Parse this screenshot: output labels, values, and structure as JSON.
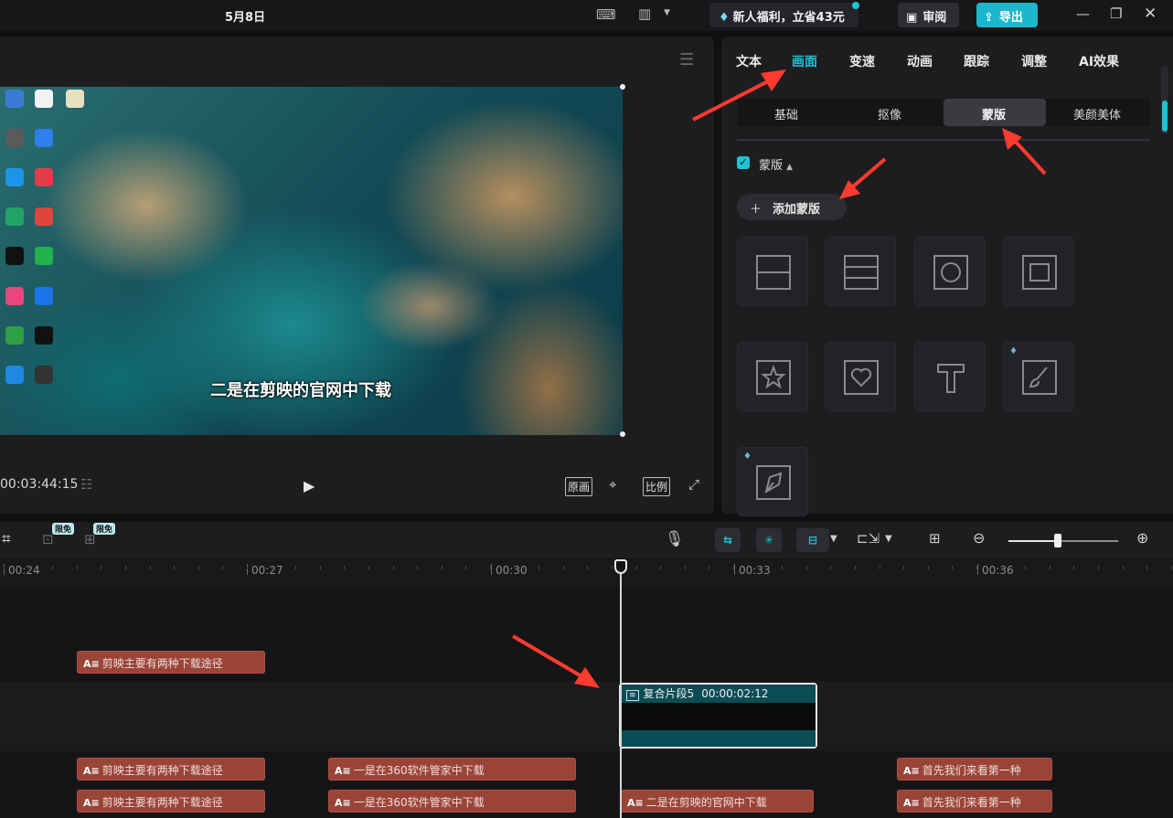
{
  "titlebar": {
    "date": "5月8日",
    "promo": "新人福利，立省43元",
    "review": "审阅",
    "export": "导出"
  },
  "player": {
    "subtitle": "二是在剪映的官网中下载",
    "timecode": "00:03:44:15",
    "original_btn": "原画",
    "ratio_btn": "比例",
    "desktop_icons": [
      {
        "color": "#3b7bd8"
      },
      {
        "color": "#f2f2f2"
      },
      {
        "color": "#e8e1c0"
      },
      {
        "color": "#5a5a5a"
      },
      {
        "color": "#2f80ed"
      },
      {
        "color": "#1d94e8"
      },
      {
        "color": "#e23b4a"
      },
      {
        "color": "#21a366"
      },
      {
        "color": "#e0453a"
      },
      {
        "color": "#111111"
      },
      {
        "color": "#22b14c"
      },
      {
        "color": "#e8467c"
      },
      {
        "color": "#1a73e8"
      },
      {
        "color": "#2ea043"
      },
      {
        "color": "#111111"
      },
      {
        "color": "#1e88e5"
      },
      {
        "color": "#333333"
      }
    ]
  },
  "panel": {
    "tabs": [
      "文本",
      "画面",
      "变速",
      "动画",
      "跟踪",
      "调整",
      "AI效果"
    ],
    "active_tab": "画面",
    "subtabs": [
      "基础",
      "抠像",
      "蒙版",
      "美颜美体"
    ],
    "active_subtab": "蒙版",
    "section_label": "蒙版",
    "add_mask": "添加蒙版",
    "mask_shapes": [
      "line-split",
      "mirror",
      "circle",
      "rectangle",
      "star",
      "heart",
      "text",
      "brush",
      "pen"
    ]
  },
  "toolbar": {
    "badge1": "限免",
    "badge2": "限免"
  },
  "timeline": {
    "ruler_labels": [
      "00:24",
      "00:27",
      "00:30",
      "00:33",
      "00:36"
    ],
    "compound": {
      "name": "复合片段5",
      "duration": "00:00:02:12"
    },
    "text_track_a": [
      {
        "label": "剪映主要有两种下载途径"
      }
    ],
    "text_track_b": [
      {
        "label": "剪映主要有两种下载途径"
      },
      {
        "label": "一是在360软件管家中下载"
      },
      {
        "label": "首先我们来看第一种"
      }
    ],
    "text_track_c": [
      {
        "label": "剪映主要有两种下载途径"
      },
      {
        "label": "一是在360软件管家中下载"
      },
      {
        "label": "二是在剪映的官网中下载"
      },
      {
        "label": "首先我们来看第一种"
      }
    ],
    "clip_icon": "A≡"
  },
  "colors": {
    "accent": "#1bc3d4",
    "clip": "#9a4438",
    "arrow": "#ff3b2f"
  }
}
